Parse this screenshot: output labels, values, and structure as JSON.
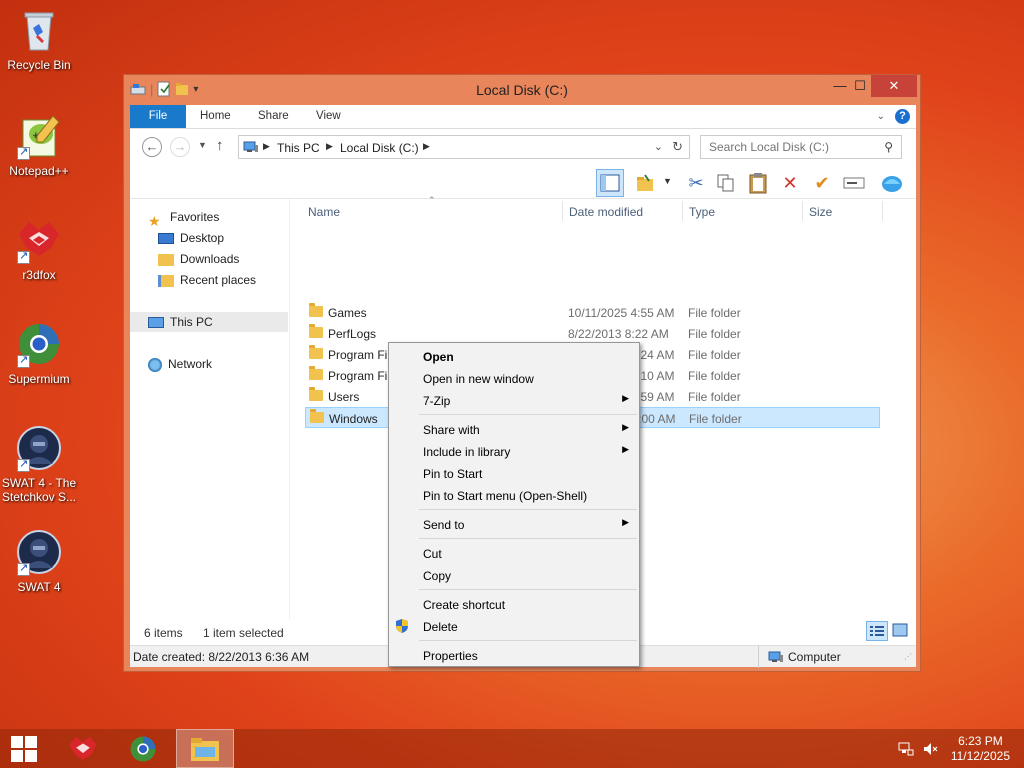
{
  "desktop_icons": [
    {
      "label": "Recycle Bin",
      "icon": "recycle-bin-icon"
    },
    {
      "label": "Notepad++",
      "icon": "notepad-plus-plus-icon"
    },
    {
      "label": "r3dfox",
      "icon": "r3dfox-icon"
    },
    {
      "label": "Supermium",
      "icon": "supermium-icon"
    },
    {
      "label": "SWAT 4 - The Stetchkov S...",
      "icon": "swat4-expansion-icon"
    },
    {
      "label": "SWAT 4",
      "icon": "swat4-icon"
    }
  ],
  "window": {
    "title": "Local Disk (C:)",
    "controls": {
      "minimize": "—",
      "maximize": "☐",
      "close": "✕"
    }
  },
  "ribbon": {
    "tabs": [
      "File",
      "Home",
      "Share",
      "View"
    ]
  },
  "address": {
    "breadcrumb": [
      "This PC",
      "Local Disk (C:)"
    ],
    "search_placeholder": "Search Local Disk (C:)"
  },
  "nav_pane": {
    "favorites_label": "Favorites",
    "favorites": [
      "Desktop",
      "Downloads",
      "Recent places"
    ],
    "this_pc_label": "This PC",
    "network_label": "Network"
  },
  "file_list": {
    "columns": [
      "Name",
      "Date modified",
      "Type",
      "Size"
    ],
    "rows": [
      {
        "name": "Games",
        "date": "10/11/2025 4:55 AM",
        "type": "File folder"
      },
      {
        "name": "PerfLogs",
        "date": "8/22/2013 8:22 AM",
        "type": "File folder"
      },
      {
        "name": "Program Files",
        "date": "10/11/2025 3:24 AM",
        "type": "File folder"
      },
      {
        "name": "Program Files (x86)",
        "date": "10/11/2025 3:10 AM",
        "type": "File folder"
      },
      {
        "name": "Users",
        "date": "10/11/2025 9:59 AM",
        "type": "File folder"
      },
      {
        "name": "Windows",
        "date": "10/11/2025 5:00 AM",
        "type": "File folder",
        "selected": true
      }
    ]
  },
  "status": {
    "item_count": "6 items",
    "selection": "1 item selected",
    "details": "Date created: 8/22/2013 6:36 AM",
    "location": "Computer"
  },
  "context_menu": {
    "groups": [
      [
        {
          "label": "Open",
          "bold": true
        },
        {
          "label": "Open in new window"
        },
        {
          "label": "7-Zip",
          "submenu": true
        }
      ],
      [
        {
          "label": "Share with",
          "submenu": true
        },
        {
          "label": "Include in library",
          "submenu": true
        },
        {
          "label": "Pin to Start"
        },
        {
          "label": "Pin to Start menu (Open-Shell)"
        }
      ],
      [
        {
          "label": "Send to",
          "submenu": true
        }
      ],
      [
        {
          "label": "Cut"
        },
        {
          "label": "Copy"
        }
      ],
      [
        {
          "label": "Create shortcut"
        },
        {
          "label": "Delete",
          "icon": "shield-icon"
        }
      ],
      [
        {
          "label": "Properties"
        }
      ]
    ]
  },
  "taskbar": {
    "time": "6:23 PM",
    "date": "11/12/2025"
  },
  "colors": {
    "file_tab": "#1979ca",
    "selection": "#cce8ff",
    "close_button": "#c7433a"
  }
}
